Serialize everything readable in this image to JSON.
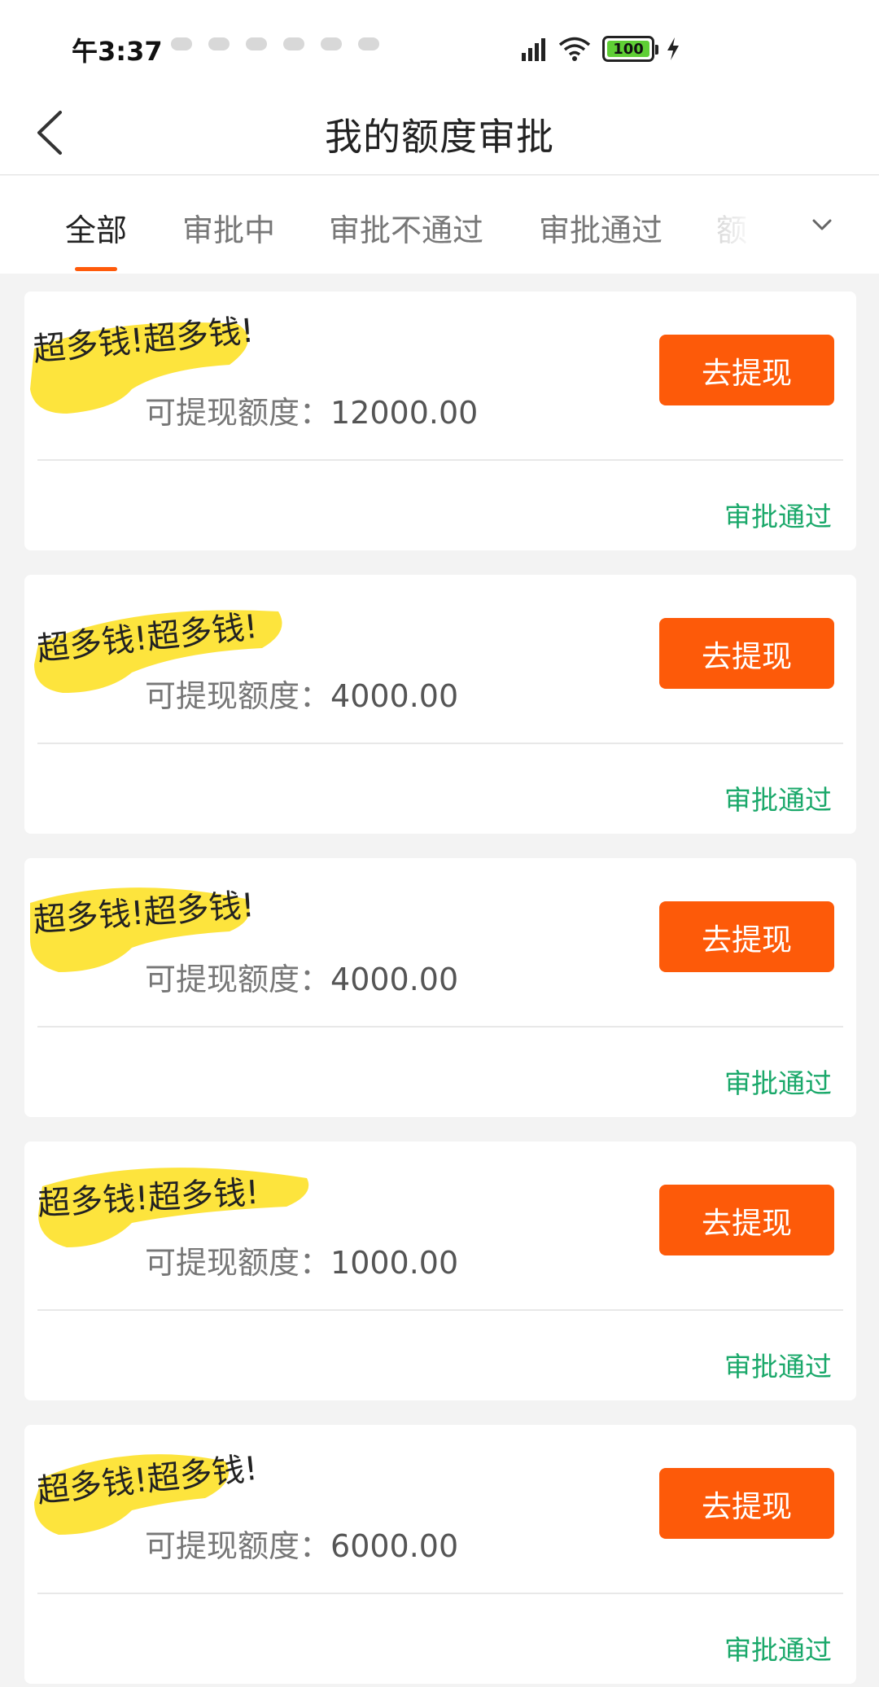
{
  "status_bar": {
    "time": "午3:37",
    "battery": "100",
    "icons": [
      "signal-icon",
      "wifi-icon",
      "battery-icon",
      "charging-icon"
    ]
  },
  "header": {
    "title": "我的额度审批",
    "back_icon": "chevron-left-icon"
  },
  "tabs": [
    {
      "label": "全部",
      "active": true
    },
    {
      "label": "审批中",
      "active": false
    },
    {
      "label": "审批不通过",
      "active": false
    },
    {
      "label": "审批通过",
      "active": false
    },
    {
      "label": "额",
      "active": false
    }
  ],
  "tab_more_icon": "chevron-down-icon",
  "cards": [
    {
      "scribble": "超多钱!超多钱!",
      "amount_label": "可提现额度：",
      "amount": "12000.00",
      "action": "去提现",
      "status": "审批通过"
    },
    {
      "scribble": "超多钱!超多钱!",
      "amount_label": "可提现额度：",
      "amount": "4000.00",
      "action": "去提现",
      "status": "审批通过"
    },
    {
      "scribble": "超多钱!超多钱!",
      "amount_label": "可提现额度：",
      "amount": "4000.00",
      "action": "去提现",
      "status": "审批通过"
    },
    {
      "scribble": "超多钱!超多钱!",
      "amount_label": "可提现额度：",
      "amount": "1000.00",
      "action": "去提现",
      "status": "审批通过"
    },
    {
      "scribble": "超多钱!超多钱!",
      "amount_label": "可提现额度：",
      "amount": "6000.00",
      "action": "去提现",
      "status": "审批通过"
    }
  ],
  "colors": {
    "accent": "#fd5a09",
    "status_green": "#1aa86a",
    "highlight_yellow": "#fde128",
    "background": "#f3f3f3"
  }
}
